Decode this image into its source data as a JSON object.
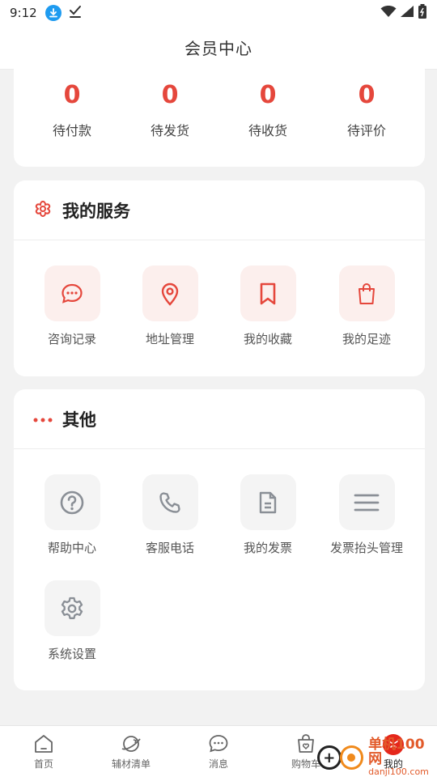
{
  "status_bar": {
    "time": "9:12"
  },
  "header": {
    "title": "会员中心"
  },
  "orders": [
    {
      "count": "0",
      "label": "待付款"
    },
    {
      "count": "0",
      "label": "待发货"
    },
    {
      "count": "0",
      "label": "待收货"
    },
    {
      "count": "0",
      "label": "待评价"
    }
  ],
  "services": {
    "title": "我的服务",
    "items": [
      {
        "label": "咨询记录",
        "icon": "chat-bubble-icon"
      },
      {
        "label": "地址管理",
        "icon": "location-pin-icon"
      },
      {
        "label": "我的收藏",
        "icon": "bookmark-icon"
      },
      {
        "label": "我的足迹",
        "icon": "shopping-bag-icon"
      }
    ]
  },
  "other": {
    "title": "其他",
    "items": [
      {
        "label": "帮助中心",
        "icon": "help-circle-icon"
      },
      {
        "label": "客服电话",
        "icon": "phone-icon"
      },
      {
        "label": "我的发票",
        "icon": "document-icon"
      },
      {
        "label": "发票抬头管理",
        "icon": "menu-lines-icon"
      },
      {
        "label": "系统设置",
        "icon": "gear-icon"
      }
    ]
  },
  "bottom_nav": [
    {
      "label": "首页",
      "icon": "home-icon"
    },
    {
      "label": "辅材清单",
      "icon": "planet-icon"
    },
    {
      "label": "消息",
      "icon": "message-icon"
    },
    {
      "label": "购物车",
      "icon": "cart-bag-icon"
    },
    {
      "label": "我的",
      "icon": "profile-face-icon"
    }
  ],
  "watermark": {
    "main": "单机100网",
    "sub": "danji100.com"
  },
  "colors": {
    "accent": "#e5473c",
    "tile_red_bg": "#fcefed",
    "tile_gray_bg": "#f4f4f4",
    "icon_gray": "#8a8f96"
  }
}
